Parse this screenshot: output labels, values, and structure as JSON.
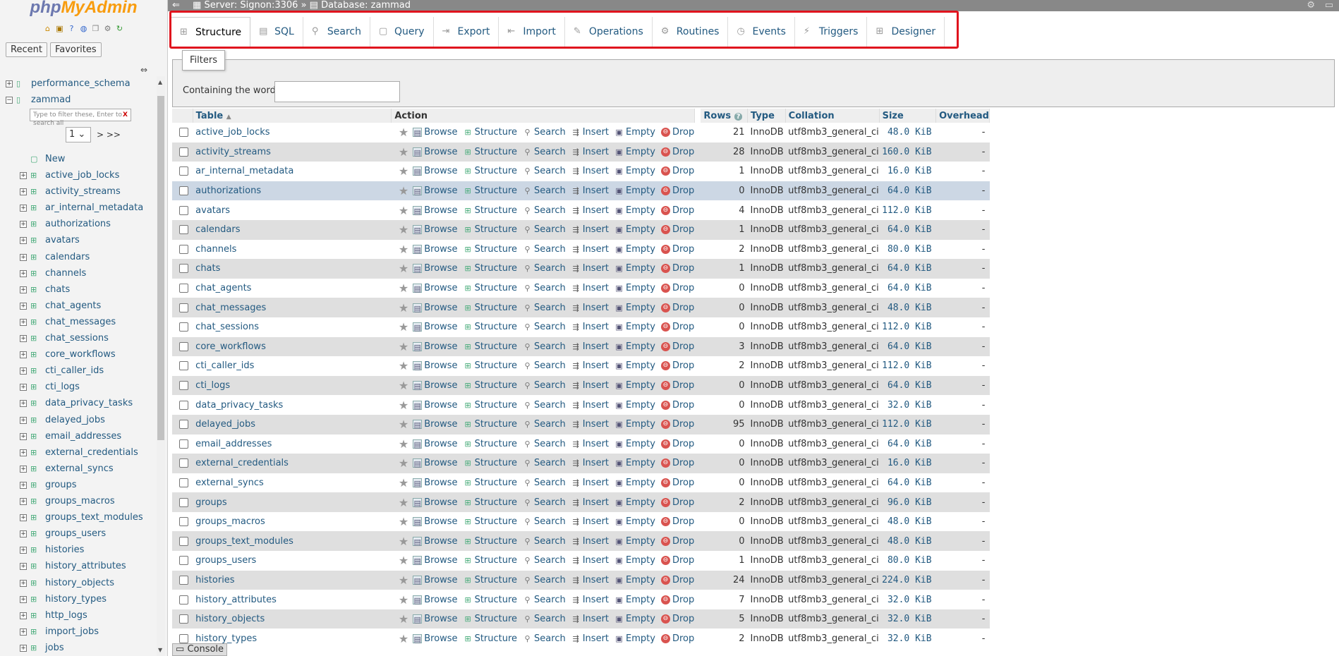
{
  "app": {
    "logo_php": "php",
    "logo_my": "MyAdmin"
  },
  "nav": {
    "recent_label": "Recent",
    "favorites_label": "Favorites",
    "collapse_glyph": "⇔",
    "databases": [
      "performance_schema",
      "zammad"
    ],
    "filter_placeholder": "Type to filter these, Enter to search all",
    "filter_clear": "X",
    "page_value": "1",
    "page_next": "> >>",
    "new_label": "New",
    "tables": [
      "active_job_locks",
      "activity_streams",
      "ar_internal_metadata",
      "authorizations",
      "avatars",
      "calendars",
      "channels",
      "chats",
      "chat_agents",
      "chat_messages",
      "chat_sessions",
      "core_workflows",
      "cti_caller_ids",
      "cti_logs",
      "data_privacy_tasks",
      "delayed_jobs",
      "email_addresses",
      "external_credentials",
      "external_syncs",
      "groups",
      "groups_macros",
      "groups_text_modules",
      "groups_users",
      "histories",
      "history_attributes",
      "history_objects",
      "history_types",
      "http_logs",
      "import_jobs",
      "jobs"
    ]
  },
  "breadcrumb": {
    "server": "Server: Signon:3306",
    "sep": "»",
    "database": "Database: zammad",
    "back": "⇐"
  },
  "tabs": [
    {
      "label": "Structure",
      "icon": "structure-icon",
      "glyph": "⊞",
      "active": true
    },
    {
      "label": "SQL",
      "icon": "sql-icon",
      "glyph": "▤",
      "active": false
    },
    {
      "label": "Search",
      "icon": "search-icon",
      "glyph": "⚲",
      "active": false
    },
    {
      "label": "Query",
      "icon": "query-icon",
      "glyph": "▢",
      "active": false
    },
    {
      "label": "Export",
      "icon": "export-icon",
      "glyph": "⇥",
      "active": false
    },
    {
      "label": "Import",
      "icon": "import-icon",
      "glyph": "⇤",
      "active": false
    },
    {
      "label": "Operations",
      "icon": "wrench-icon",
      "glyph": "✎",
      "active": false
    },
    {
      "label": "Routines",
      "icon": "routines-icon",
      "glyph": "⚙",
      "active": false
    },
    {
      "label": "Events",
      "icon": "clock-icon",
      "glyph": "◷",
      "active": false
    },
    {
      "label": "Triggers",
      "icon": "triggers-icon",
      "glyph": "⚡",
      "active": false
    },
    {
      "label": "Designer",
      "icon": "designer-icon",
      "glyph": "⊞",
      "active": false
    }
  ],
  "filters": {
    "legend": "Filters",
    "label": "Containing the word:",
    "value": ""
  },
  "table": {
    "headers": {
      "table": "Table",
      "action": "Action",
      "rows": "Rows",
      "type": "Type",
      "collation": "Collation",
      "size": "Size",
      "overhead": "Overhead"
    },
    "actions": {
      "browse": "Browse",
      "structure": "Structure",
      "search": "Search",
      "insert": "Insert",
      "empty": "Empty",
      "drop": "Drop"
    },
    "rows": [
      {
        "name": "active_job_locks",
        "rows": "21",
        "type": "InnoDB",
        "collation": "utf8mb3_general_ci",
        "size": "48.0 KiB",
        "overhead": "-"
      },
      {
        "name": "activity_streams",
        "rows": "28",
        "type": "InnoDB",
        "collation": "utf8mb3_general_ci",
        "size": "160.0 KiB",
        "overhead": "-"
      },
      {
        "name": "ar_internal_metadata",
        "rows": "1",
        "type": "InnoDB",
        "collation": "utf8mb3_general_ci",
        "size": "16.0 KiB",
        "overhead": "-"
      },
      {
        "name": "authorizations",
        "rows": "0",
        "type": "InnoDB",
        "collation": "utf8mb3_general_ci",
        "size": "64.0 KiB",
        "overhead": "-"
      },
      {
        "name": "avatars",
        "rows": "4",
        "type": "InnoDB",
        "collation": "utf8mb3_general_ci",
        "size": "112.0 KiB",
        "overhead": "-"
      },
      {
        "name": "calendars",
        "rows": "1",
        "type": "InnoDB",
        "collation": "utf8mb3_general_ci",
        "size": "64.0 KiB",
        "overhead": "-"
      },
      {
        "name": "channels",
        "rows": "2",
        "type": "InnoDB",
        "collation": "utf8mb3_general_ci",
        "size": "80.0 KiB",
        "overhead": "-"
      },
      {
        "name": "chats",
        "rows": "1",
        "type": "InnoDB",
        "collation": "utf8mb3_general_ci",
        "size": "64.0 KiB",
        "overhead": "-"
      },
      {
        "name": "chat_agents",
        "rows": "0",
        "type": "InnoDB",
        "collation": "utf8mb3_general_ci",
        "size": "64.0 KiB",
        "overhead": "-"
      },
      {
        "name": "chat_messages",
        "rows": "0",
        "type": "InnoDB",
        "collation": "utf8mb3_general_ci",
        "size": "48.0 KiB",
        "overhead": "-"
      },
      {
        "name": "chat_sessions",
        "rows": "0",
        "type": "InnoDB",
        "collation": "utf8mb3_general_ci",
        "size": "112.0 KiB",
        "overhead": "-"
      },
      {
        "name": "core_workflows",
        "rows": "3",
        "type": "InnoDB",
        "collation": "utf8mb3_general_ci",
        "size": "64.0 KiB",
        "overhead": "-"
      },
      {
        "name": "cti_caller_ids",
        "rows": "2",
        "type": "InnoDB",
        "collation": "utf8mb3_general_ci",
        "size": "112.0 KiB",
        "overhead": "-"
      },
      {
        "name": "cti_logs",
        "rows": "0",
        "type": "InnoDB",
        "collation": "utf8mb3_general_ci",
        "size": "64.0 KiB",
        "overhead": "-"
      },
      {
        "name": "data_privacy_tasks",
        "rows": "0",
        "type": "InnoDB",
        "collation": "utf8mb3_general_ci",
        "size": "32.0 KiB",
        "overhead": "-"
      },
      {
        "name": "delayed_jobs",
        "rows": "95",
        "type": "InnoDB",
        "collation": "utf8mb3_general_ci",
        "size": "112.0 KiB",
        "overhead": "-"
      },
      {
        "name": "email_addresses",
        "rows": "0",
        "type": "InnoDB",
        "collation": "utf8mb3_general_ci",
        "size": "64.0 KiB",
        "overhead": "-"
      },
      {
        "name": "external_credentials",
        "rows": "0",
        "type": "InnoDB",
        "collation": "utf8mb3_general_ci",
        "size": "16.0 KiB",
        "overhead": "-"
      },
      {
        "name": "external_syncs",
        "rows": "0",
        "type": "InnoDB",
        "collation": "utf8mb3_general_ci",
        "size": "64.0 KiB",
        "overhead": "-"
      },
      {
        "name": "groups",
        "rows": "2",
        "type": "InnoDB",
        "collation": "utf8mb3_general_ci",
        "size": "96.0 KiB",
        "overhead": "-"
      },
      {
        "name": "groups_macros",
        "rows": "0",
        "type": "InnoDB",
        "collation": "utf8mb3_general_ci",
        "size": "48.0 KiB",
        "overhead": "-"
      },
      {
        "name": "groups_text_modules",
        "rows": "0",
        "type": "InnoDB",
        "collation": "utf8mb3_general_ci",
        "size": "48.0 KiB",
        "overhead": "-"
      },
      {
        "name": "groups_users",
        "rows": "1",
        "type": "InnoDB",
        "collation": "utf8mb3_general_ci",
        "size": "80.0 KiB",
        "overhead": "-"
      },
      {
        "name": "histories",
        "rows": "24",
        "type": "InnoDB",
        "collation": "utf8mb3_general_ci",
        "size": "224.0 KiB",
        "overhead": "-"
      },
      {
        "name": "history_attributes",
        "rows": "7",
        "type": "InnoDB",
        "collation": "utf8mb3_general_ci",
        "size": "32.0 KiB",
        "overhead": "-"
      },
      {
        "name": "history_objects",
        "rows": "5",
        "type": "InnoDB",
        "collation": "utf8mb3_general_ci",
        "size": "32.0 KiB",
        "overhead": "-"
      },
      {
        "name": "history_types",
        "rows": "2",
        "type": "InnoDB",
        "collation": "utf8mb3_general_ci",
        "size": "32.0 KiB",
        "overhead": "-"
      }
    ]
  },
  "console": {
    "label": "Console"
  }
}
